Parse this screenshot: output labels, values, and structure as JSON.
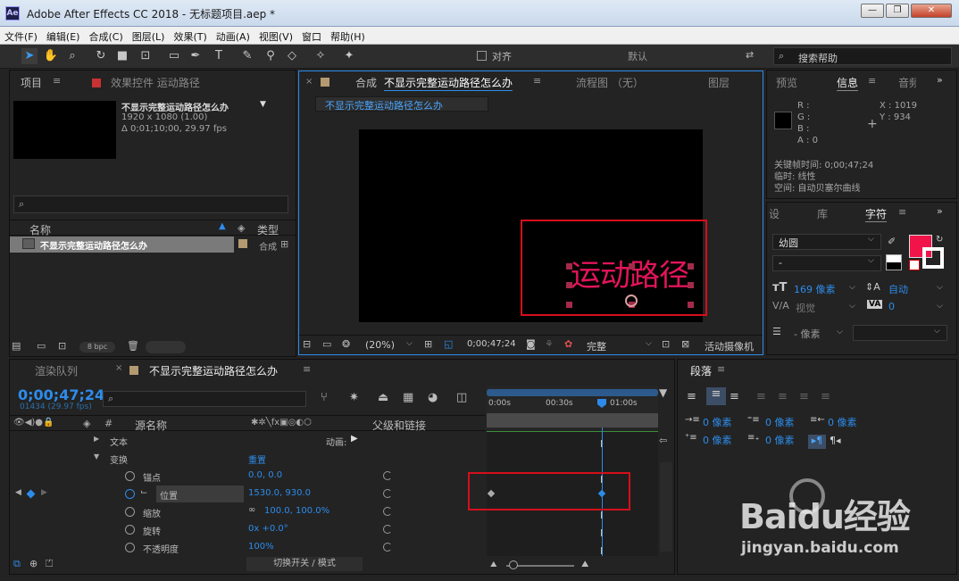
{
  "window": {
    "title": "Adobe After Effects CC 2018 - 无标题项目.aep *",
    "logo": "Ae"
  },
  "menu": [
    "文件(F)",
    "编辑(E)",
    "合成(C)",
    "图层(L)",
    "效果(T)",
    "动画(A)",
    "视图(V)",
    "窗口",
    "帮助(H)"
  ],
  "toolbar": {
    "snap_label": "对齐",
    "workspace": "默认",
    "search_placeholder": "搜索帮助"
  },
  "project_panel": {
    "tab": "项目",
    "effects_tab": "效果控件 运动路径",
    "comp_name": "不显示完整运动路径怎么办",
    "comp_size": "1920 x 1080 (1.00)",
    "comp_duration": "Δ 0;01;10;00, 29.97 fps",
    "search_placeholder": "",
    "col_name": "名称",
    "col_type": "类型",
    "items": [
      {
        "name": "不显示完整运动路径怎么办",
        "type": "合成"
      }
    ],
    "bpc": "8 bpc"
  },
  "comp_panel": {
    "tab_prefix": "合成",
    "tab_name": "不显示完整运动路径怎么办",
    "flow_tab": "流程图 （无）",
    "layer_tab": "图层",
    "sub_tab": "不显示完整运动路径怎么办",
    "canvas_text": "运动路径",
    "zoom": "(20%)",
    "timecode": "0;00;47;24",
    "quality": "完整",
    "camera": "活动摄像机"
  },
  "info_panel": {
    "tabs": [
      "预览",
      "信息",
      "音频"
    ],
    "rgba": [
      "R :",
      "G :",
      "B :",
      "A : 0"
    ],
    "x": "X : 1019",
    "y": "Y : 934",
    "keyframe_time": "关键帧时间: 0;00;47;24",
    "temporal": "临时: 线性",
    "spatial": "空间: 自动贝塞尔曲线"
  },
  "character_panel": {
    "tabs": [
      "设",
      "库",
      "字符"
    ],
    "font": "幼圆",
    "style": "-",
    "size": "169 像素",
    "leading": "自动",
    "kerning": "视觉",
    "tracking": "0",
    "stroke": "- 像素",
    "fill_color": "#f0144a"
  },
  "timeline": {
    "render_tab": "渲染队列",
    "comp_tab": "不显示完整运动路径怎么办",
    "timecode": "0;00;47;24",
    "frames": "01434 (29.97 fps)",
    "col_source": "源名称",
    "col_parent": "父级和链接",
    "ruler": [
      "0:00s",
      "00:30s",
      "01:00s"
    ],
    "rows": [
      {
        "name": "文本",
        "value": "动画:",
        "expand": "▶"
      },
      {
        "name": "变换",
        "value": "重置",
        "expand": "▼"
      },
      {
        "name": "锚点",
        "value": "0.0, 0.0"
      },
      {
        "name": "位置",
        "value": "1530.0, 930.0"
      },
      {
        "name": "缩放",
        "value": "100.0, 100.0%"
      },
      {
        "name": "旋转",
        "value": "0x +0.0°"
      },
      {
        "name": "不透明度",
        "value": "100%"
      }
    ],
    "switch_label": "切换开关 / 模式"
  },
  "paragraph_panel": {
    "title": "段落",
    "vals": [
      "0 像素",
      "0 像素",
      "0 像素",
      "0 像素",
      "0 像素"
    ]
  },
  "watermark": {
    "brand": "Baidu经验",
    "url": "jingyan.baidu.com"
  }
}
